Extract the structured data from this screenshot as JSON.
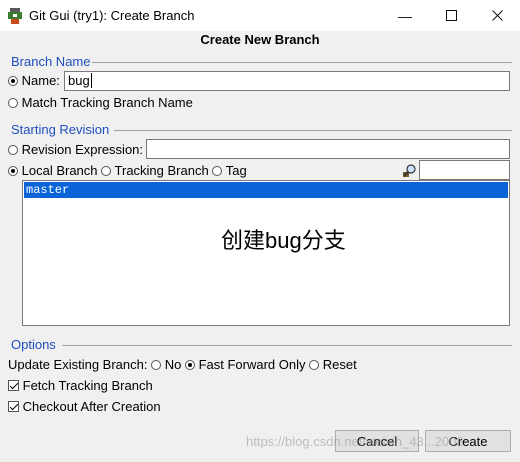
{
  "window": {
    "title": "Git Gui (try1): Create Branch"
  },
  "dialog": {
    "heading": "Create New Branch"
  },
  "branch_name": {
    "group_title": "Branch Name",
    "name_label": "Name:",
    "name_value": "bug",
    "match_label": "Match Tracking Branch Name"
  },
  "starting_revision": {
    "group_title": "Starting Revision",
    "revision_expression_label": "Revision Expression:",
    "revision_expression_value": "",
    "local_branch_label": "Local Branch",
    "tracking_branch_label": "Tracking Branch",
    "tag_label": "Tag",
    "filter_value": "",
    "branches": [
      "master"
    ],
    "selected_branch": "master"
  },
  "overlay_annotation": "创建bug分支",
  "options": {
    "group_title": "Options",
    "update_existing_label": "Update Existing Branch:",
    "no_label": "No",
    "fast_forward_label": "Fast Forward Only",
    "reset_label": "Reset",
    "fetch_tracking_label": "Fetch Tracking Branch",
    "checkout_after_label": "Checkout After Creation"
  },
  "buttons": {
    "cancel": "Cancel",
    "create": "Create"
  },
  "watermark": "https://blog.csdn.net/weixin_43...2008"
}
